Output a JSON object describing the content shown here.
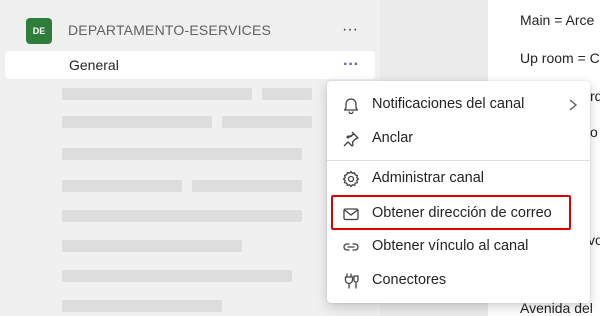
{
  "team": {
    "avatar_initials": "DE",
    "avatar_color": "#2e7d3a",
    "name": "DEPARTAMENTO-ESERVICES",
    "more_label": "···"
  },
  "channel": {
    "name": "General",
    "more_label": "···"
  },
  "menu": {
    "items": [
      {
        "label": "Notificaciones del canal",
        "icon": "bell-icon",
        "submenu": true
      },
      {
        "label": "Anclar",
        "icon": "pin-icon"
      },
      {
        "label": "Administrar canal",
        "icon": "gear-icon"
      },
      {
        "label": "Obtener dirección de correo",
        "icon": "mail-icon",
        "highlighted": true
      },
      {
        "label": "Obtener vínculo al canal",
        "icon": "link-icon"
      },
      {
        "label": "Conectores",
        "icon": "connector-icon"
      }
    ],
    "highlight_color": "#e00000"
  },
  "chat": {
    "lines": [
      "Main = Arce",
      "Up room = C",
      "rd",
      "o",
      "vo",
      "Avenida del"
    ]
  }
}
